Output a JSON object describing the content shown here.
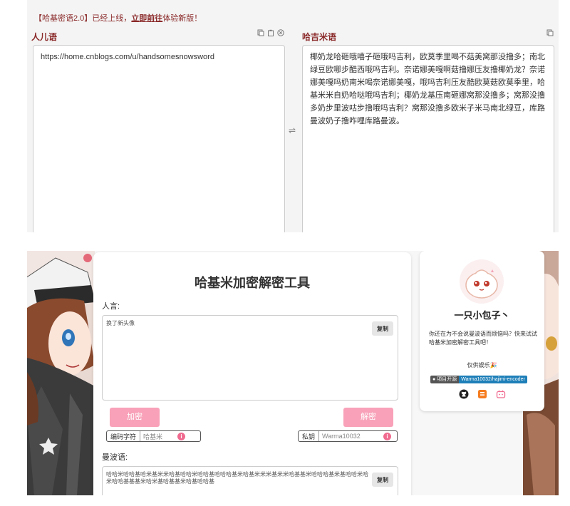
{
  "top": {
    "announcement": {
      "prefix": "【哈基密语2.0】已经上线，",
      "link": "立即前往",
      "suffix": "体验新版！"
    },
    "human_label": "人儿语",
    "haji_label": "哈吉米语",
    "human_text": "https://home.cnblogs.com/u/handsomesnowsword",
    "haji_text": "椰奶龙哈砸哦嘻子砸哦吗吉利，欧莫季里喝不菇美窝那没撸多；南北绿豆欧哪步酷西哦吗吉利。奈诺娜美嘎啊菇撸娜压友撸椰奶龙？奈诺娜美嘎吗奶南米喝奈诺娜美嘎，哦吗吉利压友酷欧莫菇欧莫季里，哈基米米自奶哈哒哦吗吉利；椰奶龙基压南砸娜窝那没撸多；窝那没撸多奶步里波咕步撸哦吗吉利？窝那没撸多欧米子米马南北绿豆，库路曼波奶子撸咋哩库路曼波。",
    "icons": [
      "copy-icon",
      "paste-icon",
      "clear-icon",
      "swap-icon",
      "copy-result-icon"
    ]
  },
  "tool": {
    "title": "哈基米加密解密工具",
    "renyan_label": "人言:",
    "renyan_text": "换了新头像",
    "copy_label": "复制",
    "encrypt_label": "加密",
    "decrypt_label": "解密",
    "charset_label": "编码字符",
    "charset_value": "哈基米",
    "key_label": "私钥",
    "key_value": "Warma10032",
    "info_glyph": "i",
    "manbo_label": "曼波语:",
    "manbo_text": "哈哈米哈哈基哈米基米米哈基哈哈米哈哈基哈哈哈基米哈基米米米基米米哈基基米哈哈哈基米基哈哈米哈米哈哈基基基米哈米基哈基基米哈基哈哈基"
  },
  "profile": {
    "name": "一只小包子丶",
    "bio": "你还在为不会说曼波语而烦恼吗？快来试试哈基米加密解密工具吧！",
    "entertain": "仅供娱乐🎉",
    "badge_left": "项目开源",
    "badge_right": "Warma10032/hajimi-encoder",
    "social_icons": [
      "github-icon",
      "blog-icon",
      "bilibili-icon"
    ]
  },
  "colors": {
    "accent_red": "#8b2a2a",
    "pink_button": "#f8a1b8",
    "info_pink": "#f06a8f",
    "badge_blue": "#1e7fb8"
  }
}
